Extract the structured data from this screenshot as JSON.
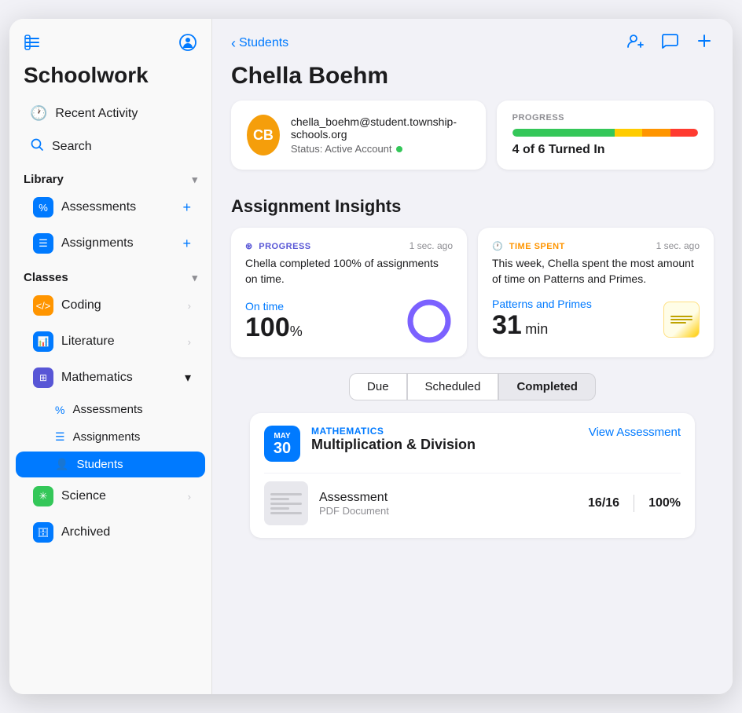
{
  "app": {
    "title": "Schoolwork"
  },
  "sidebar": {
    "toggle_icon": "sidebar-icon",
    "profile_icon": "person-circle-icon",
    "nav": [
      {
        "id": "recent-activity",
        "icon": "clock-icon",
        "label": "Recent Activity"
      },
      {
        "id": "search",
        "icon": "search-icon",
        "label": "Search"
      }
    ],
    "sections": [
      {
        "id": "library",
        "label": "Library",
        "collapsed": false,
        "items": [
          {
            "id": "assessments",
            "icon": "percent-icon",
            "icon_color": "blue",
            "label": "Assessments"
          },
          {
            "id": "assignments",
            "icon": "doc-icon",
            "icon_color": "blue",
            "label": "Assignments"
          }
        ]
      },
      {
        "id": "classes",
        "label": "Classes",
        "collapsed": false,
        "items": [
          {
            "id": "coding",
            "icon": "brackets-icon",
            "icon_color": "orange",
            "label": "Coding",
            "has_chevron": true
          },
          {
            "id": "literature",
            "icon": "chart-icon",
            "icon_color": "blue",
            "label": "Literature",
            "has_chevron": true
          },
          {
            "id": "mathematics",
            "icon": "grid-icon",
            "icon_color": "purple",
            "label": "Mathematics",
            "expanded": true,
            "sub_items": [
              {
                "id": "math-assessments",
                "icon": "percent-icon",
                "label": "Assessments",
                "active": false
              },
              {
                "id": "math-assignments",
                "icon": "doc-icon",
                "label": "Assignments",
                "active": false
              },
              {
                "id": "math-students",
                "icon": "person-icon",
                "label": "Students",
                "active": true
              }
            ]
          },
          {
            "id": "science",
            "icon": "leaf-icon",
            "icon_color": "green",
            "label": "Science",
            "has_chevron": true
          },
          {
            "id": "archived",
            "icon": "archive-icon",
            "icon_color": "blue",
            "label": "Archived"
          }
        ]
      }
    ]
  },
  "main": {
    "breadcrumb": "Students",
    "student_name": "Chella Boehm",
    "student_email": "chella_boehm@student.township-schools.org",
    "student_status": "Status: Active Account",
    "student_avatar_initials": "CB",
    "topbar_actions": [
      {
        "id": "add-student",
        "icon": "person-add-icon"
      },
      {
        "id": "message",
        "icon": "chat-icon"
      },
      {
        "id": "add",
        "icon": "plus-icon"
      }
    ],
    "progress_label": "PROGRESS",
    "progress_summary": "4 of 6 Turned In",
    "progress_bar": {
      "green_pct": 55,
      "yellow_pct": 15,
      "orange_pct": 15,
      "red_pct": 15
    },
    "insights_title": "Assignment Insights",
    "insight_progress": {
      "type_label": "PROGRESS",
      "timestamp": "1 sec. ago",
      "description": "Chella completed 100% of assignments on time.",
      "metric_label": "On time",
      "metric_value": "100",
      "metric_unit": "%"
    },
    "insight_time": {
      "type_label": "TIME SPENT",
      "timestamp": "1 sec. ago",
      "description": "This week, Chella spent the most amount of time on Patterns and Primes.",
      "metric_subject": "Patterns and Primes",
      "metric_value": "31",
      "metric_unit": "min"
    },
    "filters": [
      {
        "id": "due",
        "label": "Due"
      },
      {
        "id": "scheduled",
        "label": "Scheduled"
      },
      {
        "id": "completed",
        "label": "Completed",
        "active": true
      }
    ],
    "assignment": {
      "date_month": "MAY",
      "date_day": "30",
      "class_label": "MATHEMATICS",
      "title": "Multiplication & Division",
      "view_button": "View Assessment",
      "item_name": "Assessment",
      "item_type": "PDF Document",
      "item_score": "16/16",
      "item_pct": "100%"
    }
  }
}
